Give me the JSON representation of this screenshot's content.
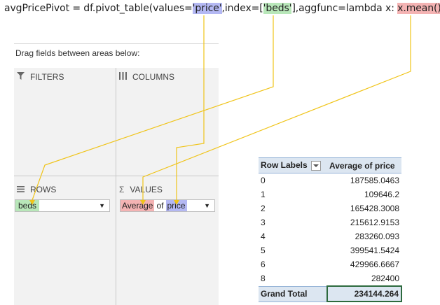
{
  "code": {
    "prefix": "avgPricePivot = df.pivot_table(values=",
    "values_arg": "'price'",
    "mid1": ",index=[",
    "index_arg": "'beds'",
    "mid2": "],aggfunc=lambda x: ",
    "agg_arg": "x.mean()",
    "suffix": ")"
  },
  "pane": {
    "instruction": "Drag fields between areas below:",
    "filters_label": "FILTERS",
    "columns_label": "COLUMNS",
    "rows_label": "ROWS",
    "values_label": "VALUES",
    "rows_field": "beds",
    "values_field": {
      "agg": "Average",
      "of": "of",
      "name": "price"
    }
  },
  "pivot": {
    "header_row_labels": "Row Labels",
    "header_value": "Average of price",
    "rows": [
      {
        "label": "0",
        "value": "187585.0463"
      },
      {
        "label": "1",
        "value": "109646.2"
      },
      {
        "label": "2",
        "value": "165428.3008"
      },
      {
        "label": "3",
        "value": "215612.9153"
      },
      {
        "label": "4",
        "value": "283260.093"
      },
      {
        "label": "5",
        "value": "399541.5424"
      },
      {
        "label": "6",
        "value": "429966.6667"
      },
      {
        "label": "8",
        "value": "282400"
      }
    ],
    "total_label": "Grand Total",
    "total_value": "234144.264"
  },
  "colors": {
    "values_highlight": "#b4b8f3",
    "index_highlight": "#b8e7b9",
    "agg_highlight": "#f4b3b3",
    "connector": "#f0c419",
    "pivot_header": "#dce6f1"
  }
}
